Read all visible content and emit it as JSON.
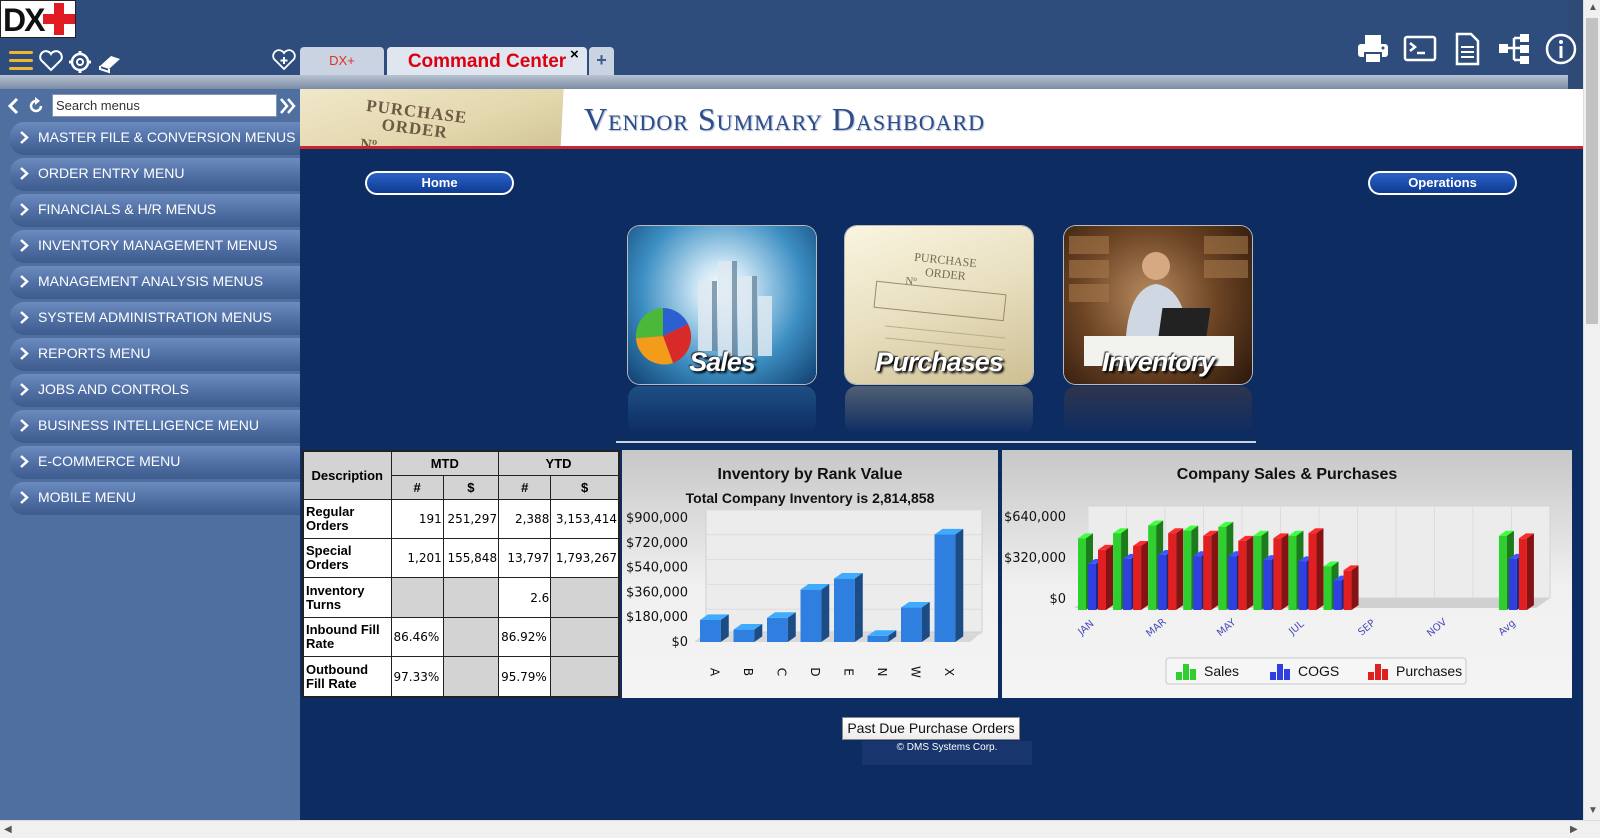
{
  "header": {
    "logo_text": "DX",
    "tabs": [
      {
        "label": "DX+"
      },
      {
        "label": "Command Center"
      }
    ],
    "tab_close": "×",
    "tab_add": "+"
  },
  "sidebar": {
    "search_placeholder": "Search menus",
    "items": [
      {
        "label": "MASTER FILE & CONVERSION MENUS"
      },
      {
        "label": "ORDER ENTRY MENU"
      },
      {
        "label": "FINANCIALS & H/R MENUS"
      },
      {
        "label": "INVENTORY MANAGEMENT MENUS"
      },
      {
        "label": "MANAGEMENT ANALYSIS MENUS"
      },
      {
        "label": "SYSTEM ADMINISTRATION MENUS"
      },
      {
        "label": "REPORTS MENU"
      },
      {
        "label": "JOBS AND CONTROLS"
      },
      {
        "label": "BUSINESS INTELLIGENCE MENU"
      },
      {
        "label": "E-COMMERCE MENU"
      },
      {
        "label": "MOBILE MENU"
      }
    ]
  },
  "banner": {
    "po_line1": "PURCHASE",
    "po_line2": "ORDER",
    "po_no": "Nº",
    "title": "Vendor Summary Dashboard"
  },
  "buttons": {
    "home": "Home",
    "operations": "Operations",
    "past_due": "Past Due Purchase Orders"
  },
  "tiles": [
    {
      "label": "Sales"
    },
    {
      "label": "Purchases"
    },
    {
      "label": "Inventory"
    }
  ],
  "table": {
    "header_description": "Description",
    "header_mtd": "MTD",
    "header_ytd": "YTD",
    "sub_count": "#",
    "sub_amount": "$",
    "rows": [
      {
        "desc": "Regular Orders",
        "mtd_count": "191",
        "mtd_amount": "251,297",
        "ytd_count": "2,388",
        "ytd_amount": "3,153,414"
      },
      {
        "desc": "Special Orders",
        "mtd_count": "1,201",
        "mtd_amount": "155,848",
        "ytd_count": "13,797",
        "ytd_amount": "1,793,267"
      },
      {
        "desc": "Inventory Turns",
        "mtd_count": "",
        "mtd_amount": "",
        "ytd_count": "2.6",
        "ytd_amount": ""
      },
      {
        "desc": "Inbound Fill Rate",
        "mtd_count": "86.46%",
        "mtd_amount": "",
        "ytd_count": "86.92%",
        "ytd_amount": ""
      },
      {
        "desc": "Outbound Fill Rate",
        "mtd_count": "97.33%",
        "mtd_amount": "",
        "ytd_count": "95.79%",
        "ytd_amount": ""
      }
    ]
  },
  "chart_data": [
    {
      "type": "bar",
      "title": "Inventory by Rank Value",
      "subtitle": "Total Company Inventory is 2,814,858",
      "categories": [
        "A",
        "B",
        "C",
        "D",
        "E",
        "N",
        "W",
        "X"
      ],
      "values": [
        160000,
        90000,
        175000,
        380000,
        460000,
        45000,
        250000,
        780000
      ],
      "yticks": [
        "$900,000",
        "$720,000",
        "$540,000",
        "$360,000",
        "$180,000",
        "$0"
      ],
      "ylim": [
        0,
        900000
      ],
      "color": "#2f7fe0"
    },
    {
      "type": "bar",
      "title": "Company Sales & Purchases",
      "x_ticks": [
        "JAN",
        "MAR",
        "MAY",
        "JUL",
        "SEP",
        "NOV",
        "Avg"
      ],
      "yticks": [
        "$640,000",
        "$320,000",
        "$0"
      ],
      "ylim": [
        0,
        640000
      ],
      "categories": [
        "JAN",
        "FEB",
        "MAR",
        "APR",
        "MAY",
        "JUN",
        "JUL",
        "AUG",
        "SEP",
        "OCT",
        "NOV",
        "DEC",
        "Avg"
      ],
      "series": [
        {
          "name": "Sales",
          "color": "#2fcf2f",
          "values": [
            560000,
            600000,
            660000,
            620000,
            650000,
            580000,
            580000,
            340000,
            0,
            0,
            0,
            0,
            580000
          ]
        },
        {
          "name": "COGS",
          "color": "#2f3fe0",
          "values": [
            360000,
            400000,
            430000,
            420000,
            420000,
            390000,
            380000,
            230000,
            0,
            0,
            0,
            0,
            400000
          ]
        },
        {
          "name": "Purchases",
          "color": "#e02020",
          "values": [
            470000,
            500000,
            600000,
            580000,
            540000,
            560000,
            600000,
            310000,
            0,
            0,
            0,
            0,
            560000
          ]
        }
      ],
      "legend": "bottom"
    }
  ],
  "footer": {
    "copyright": "© DMS Systems Corp."
  }
}
